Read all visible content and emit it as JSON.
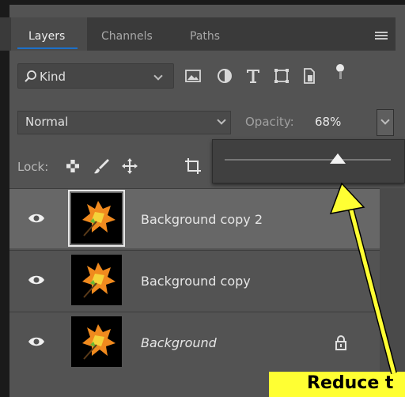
{
  "tabs": [
    {
      "label": "Layers",
      "active": true
    },
    {
      "label": "Channels",
      "active": false
    },
    {
      "label": "Paths",
      "active": false
    }
  ],
  "filter": {
    "kind_label": "Kind",
    "icons": [
      "search-icon",
      "image-filter-icon",
      "adjustment-filter-icon",
      "type-filter-icon",
      "shape-filter-icon",
      "smart-object-filter-icon",
      "filter-toggle-icon"
    ]
  },
  "blend_mode": {
    "value": "Normal"
  },
  "opacity": {
    "label": "Opacity:",
    "value": "68%",
    "level": 0.68
  },
  "lock": {
    "label": "Lock:",
    "icons": [
      "lock-transparent-pixels-icon",
      "lock-image-pixels-icon",
      "lock-position-icon",
      "lock-artboard-icon"
    ]
  },
  "layers": [
    {
      "name": "Background copy 2",
      "selected": true,
      "italic": false,
      "locked": false,
      "visible": true
    },
    {
      "name": "Background copy",
      "selected": false,
      "italic": false,
      "locked": false,
      "visible": true
    },
    {
      "name": "Background",
      "selected": false,
      "italic": true,
      "locked": true,
      "visible": true
    }
  ],
  "callout": {
    "text": "Reduce t"
  },
  "colors": {
    "panel_bg": "#535353",
    "tab_bar": "#3a3a3a",
    "selected_row": "#676767",
    "accent": "#1d70c9",
    "callout": "#ffff33"
  }
}
